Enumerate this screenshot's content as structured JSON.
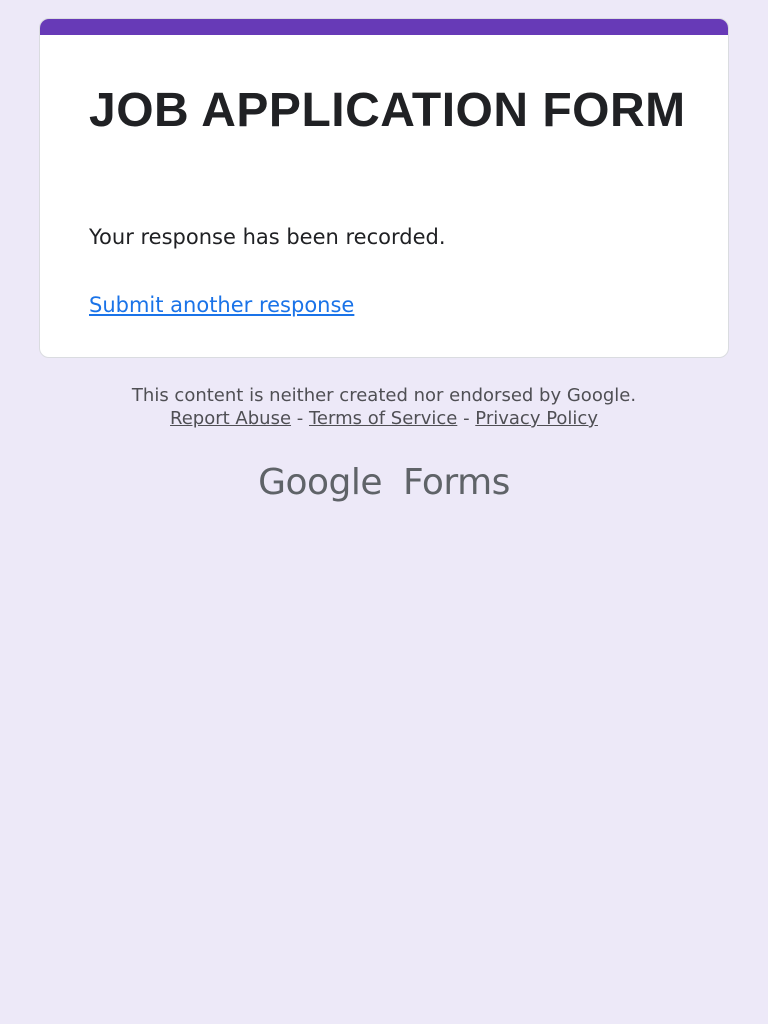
{
  "colors": {
    "page_background": "#ede9f8",
    "accent": "#673ab7",
    "link": "#1a73e8",
    "text": "#202124",
    "footer_text": "#4f4f54",
    "brand_text": "#5f6368"
  },
  "card": {
    "title": "JOB APPLICATION FORM",
    "confirmation": "Your response has been recorded.",
    "submit_another_link": "Submit another response"
  },
  "footer": {
    "disclaimer": "This content is neither created nor endorsed by Google.",
    "links": {
      "report_abuse": "Report Abuse",
      "separator": "-",
      "terms_of_service": "Terms of Service",
      "privacy_policy": "Privacy Policy"
    },
    "brand": {
      "google": "Google",
      "forms": "Forms"
    }
  }
}
